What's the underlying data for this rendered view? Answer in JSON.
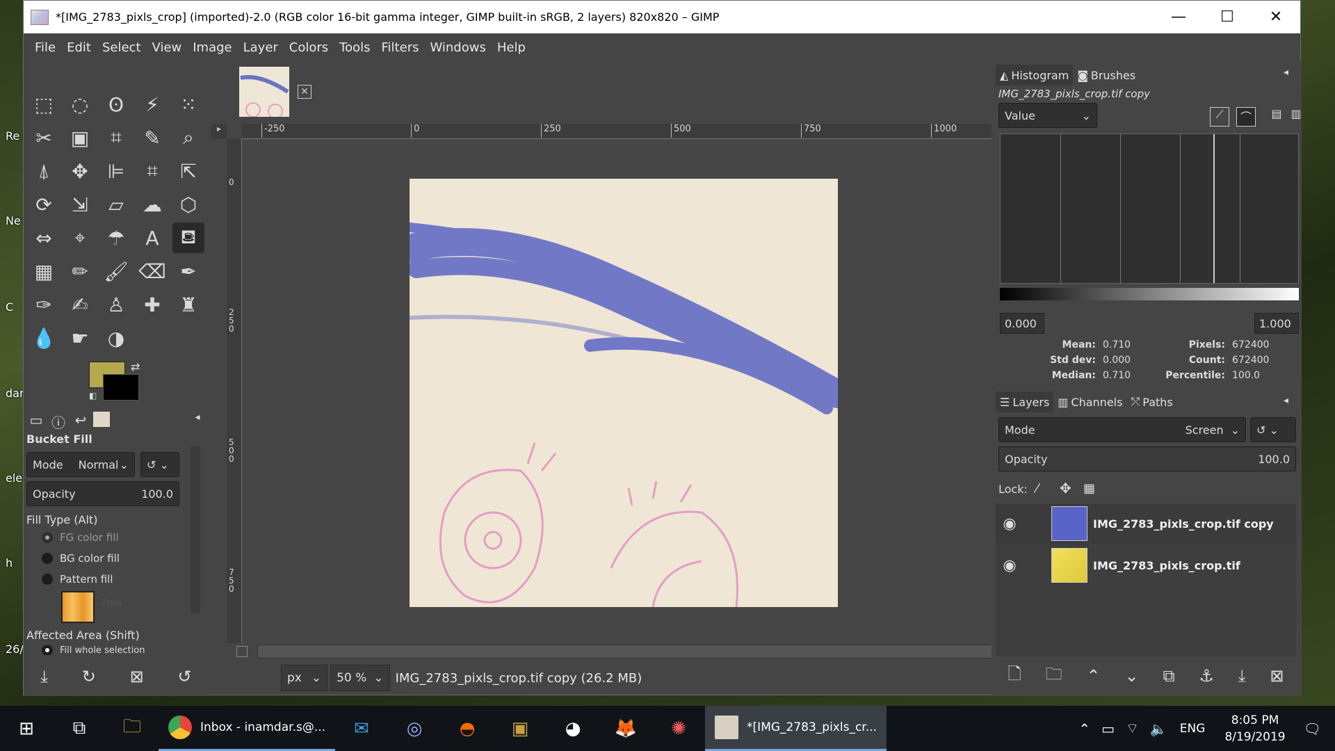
{
  "window": {
    "title": "*[IMG_2783_pixls_crop] (imported)-2.0 (RGB color 16-bit gamma integer, GIMP built-in sRGB, 2 layers) 820x820 – GIMP",
    "minimize": "—",
    "maximize": "☐",
    "close": "✕"
  },
  "menu": [
    "File",
    "Edit",
    "Select",
    "View",
    "Image",
    "Layer",
    "Colors",
    "Tools",
    "Filters",
    "Windows",
    "Help"
  ],
  "colors": {
    "fg": "#b5a94e",
    "bg": "#000000",
    "accent": "#5a64c8"
  },
  "tool_options": {
    "title": "Bucket Fill",
    "mode_label": "Mode",
    "mode_value": "Normal",
    "opacity_label": "Opacity",
    "opacity_value": "100.0",
    "fill_type_label": "Fill Type  (Alt)",
    "fill_fg": "FG color fill",
    "fill_bg": "BG color fill",
    "fill_pattern": "Pattern fill",
    "pattern_name": "Pine",
    "affected_label": "Affected Area  (Shift)",
    "affected_first": "Fill whole selection"
  },
  "rulers": {
    "top": [
      "-250",
      "0",
      "250",
      "500",
      "750",
      "1000"
    ],
    "left": [
      "0",
      "250",
      "500",
      "750"
    ]
  },
  "status": {
    "unit": "px",
    "zoom": "50 %",
    "message": "IMG_2783_pixls_crop.tif copy (26.2 MB)"
  },
  "histogram": {
    "tab1": "Histogram",
    "tab2": "Brushes",
    "subtitle": "IMG_2783_pixls_crop.tif copy",
    "channel": "Value",
    "range_low": "0.000",
    "range_high": "1.000",
    "mean_label": "Mean:",
    "mean": "0.710",
    "stddev_label": "Std dev:",
    "stddev": "0.000",
    "median_label": "Median:",
    "median": "0.710",
    "pixels_label": "Pixels:",
    "pixels": "672400",
    "count_label": "Count:",
    "count": "672400",
    "percentile_label": "Percentile:",
    "percentile": "100.0"
  },
  "layers_panel": {
    "tab1": "Layers",
    "tab2": "Channels",
    "tab3": "Paths",
    "mode_label": "Mode",
    "mode_value": "Screen",
    "opacity_label": "Opacity",
    "opacity_value": "100.0",
    "lock_label": "Lock:",
    "layers": [
      {
        "name": "IMG_2783_pixls_crop.tif copy",
        "thumb_color": "#5a64c8"
      },
      {
        "name": "IMG_2783_pixls_crop.tif",
        "thumb_color": "#e8d44a"
      }
    ]
  },
  "taskbar": {
    "apps": [
      {
        "label": "Inbox - inamdar.s@...",
        "color": "#e8453c"
      },
      {
        "label": "*[IMG_2783_pixls_cr...",
        "color": "#d8d0c0"
      }
    ],
    "lang": "ENG",
    "time": "8:05 PM",
    "date": "8/19/2019"
  },
  "desktop_labels": [
    "Re",
    "Ne",
    "C",
    "dar",
    "elec",
    "h",
    "26/"
  ]
}
